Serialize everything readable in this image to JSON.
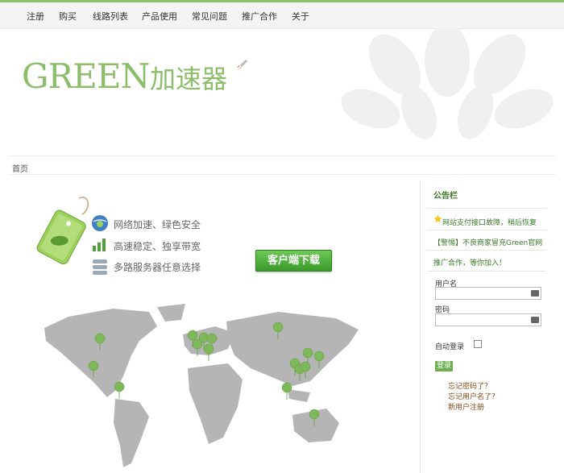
{
  "nav": {
    "items": [
      "注册",
      "购买",
      "线路列表",
      "产品使用",
      "常见问题",
      "推广合作",
      "关于"
    ]
  },
  "logo": {
    "text_en": "GREEN",
    "text_cn": "加速器"
  },
  "breadcrumb": {
    "home": "首页"
  },
  "features": [
    {
      "icon": "globe-icon",
      "text": "网络加速、绿色安全"
    },
    {
      "icon": "signal-bars-icon",
      "text": "高速稳定、独享带宽"
    },
    {
      "icon": "server-icon",
      "text": "多路服务器任意选择"
    }
  ],
  "download_button": "客户端下载",
  "sidebar": {
    "title": "公告栏",
    "notices": [
      "网站支付接口故障，稍后恢复",
      "【警惕】不良商家冒充Green官网",
      "推广合作，等你加入！"
    ],
    "username_label": "用户名",
    "password_label": "密码",
    "remember_label": "自动登录",
    "login_button": "登录",
    "links": [
      "忘记密码了？",
      "忘记用户名了？",
      "新用户注册"
    ]
  },
  "colors": {
    "accent": "#8fc36b",
    "brand_green": "#8bbd6a",
    "link_brown": "#8a4b1a",
    "map_gray": "#b5b5b5",
    "pin_green": "#7fb85a"
  }
}
